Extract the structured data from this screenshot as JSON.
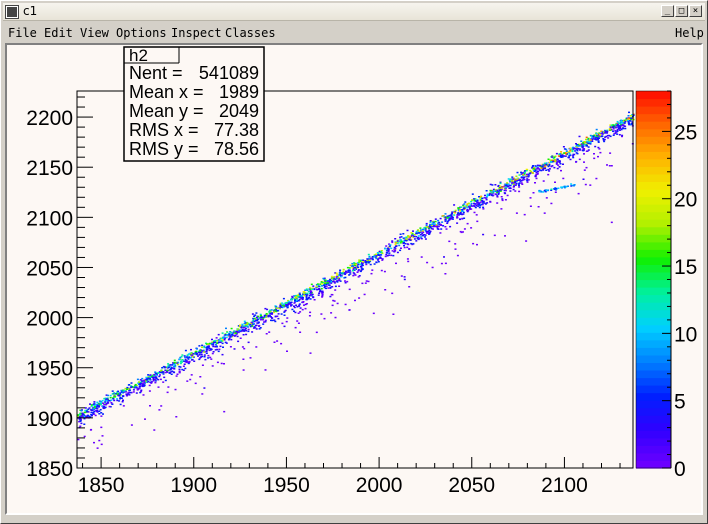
{
  "window": {
    "title": "c1",
    "controls": {
      "minimize": "_",
      "maximize": "□",
      "close": "×"
    }
  },
  "menubar": {
    "items": [
      "File",
      "Edit",
      "View",
      "Options",
      "Inspect",
      "Classes"
    ],
    "help": "Help"
  },
  "colors": {
    "canvas_bg": "#fdf8f4",
    "window_bg": "#d4d0c8",
    "palette": [
      "#6b00ff",
      "#3000ff",
      "#0020ff",
      "#0080ff",
      "#00d0ff",
      "#00f0a0",
      "#10f000",
      "#b0f000",
      "#f0f000",
      "#ffb000",
      "#ff6000",
      "#ff0000"
    ]
  },
  "stats_box": {
    "name": "h2",
    "rows": [
      {
        "label": "Nent = ",
        "value": "541089"
      },
      {
        "label": "Mean x = ",
        "value": "1989"
      },
      {
        "label": "Mean y = ",
        "value": "2049"
      },
      {
        "label": "RMS x  = ",
        "value": "77.38"
      },
      {
        "label": "RMS y  = ",
        "value": "78.56"
      }
    ]
  },
  "chart_data": {
    "type": "heatmap",
    "title": "",
    "xlabel": "",
    "ylabel": "",
    "xlim": [
      1837,
      2137
    ],
    "ylim": [
      1850,
      2226
    ],
    "x_ticks": [
      1850,
      1900,
      1950,
      2000,
      2050,
      2100
    ],
    "y_ticks": [
      1850,
      1900,
      1950,
      2000,
      2050,
      2100,
      2150,
      2200
    ],
    "z_ticks": [
      0,
      5,
      10,
      15,
      20,
      25
    ],
    "zlim": [
      0,
      28
    ],
    "entries": 541089,
    "mean_x": 1989,
    "mean_y": 2049,
    "rms_x": 77.38,
    "rms_y": 78.56,
    "correlation_band": {
      "description": "main diagonal ridge",
      "start": [
        1837,
        1903
      ],
      "end": [
        2137,
        2202
      ]
    },
    "secondary_blob": {
      "x": [
        2085,
        2105
      ],
      "y": [
        2126,
        2133
      ]
    },
    "grid": false,
    "legend": "color-scale-right"
  }
}
